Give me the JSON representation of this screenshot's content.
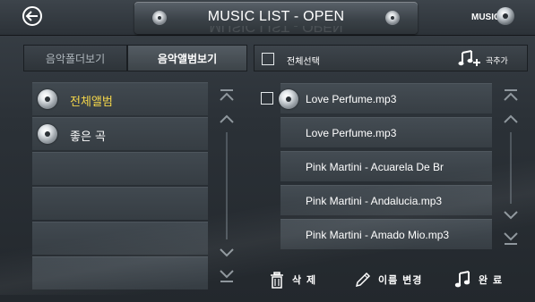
{
  "header": {
    "title": "MUSIC LIST - OPEN",
    "logo_text": "MUSIC",
    "back_icon": "back-arrow-icon"
  },
  "left_panel": {
    "tabs": [
      {
        "label": "음악폴더보기",
        "active": false
      },
      {
        "label": "음악앨범보기",
        "active": true
      }
    ],
    "items": [
      {
        "label": "전체앨범",
        "selected": true
      },
      {
        "label": "좋은 곡",
        "selected": false
      },
      {
        "label": ""
      },
      {
        "label": ""
      },
      {
        "label": ""
      },
      {
        "label": ""
      }
    ]
  },
  "right_panel": {
    "select_all_label": "전체선택",
    "add_song_label": "곡추가",
    "songs": [
      {
        "label": "Love Perfume.mp3",
        "checkbox": true,
        "disc": true
      },
      {
        "label": "Love Perfume.mp3"
      },
      {
        "label": "Pink Martini - Acuarela De Br"
      },
      {
        "label": "Pink Martini - Andalucia.mp3"
      },
      {
        "label": "Pink Martini - Amado Mio.mp3"
      }
    ]
  },
  "actions": {
    "delete_label": "삭 제",
    "rename_label": "이름 변경",
    "done_label": "완 료"
  },
  "colors": {
    "selected_text": "#f4d64a",
    "text": "#ffffff",
    "background": "#2b3137"
  }
}
